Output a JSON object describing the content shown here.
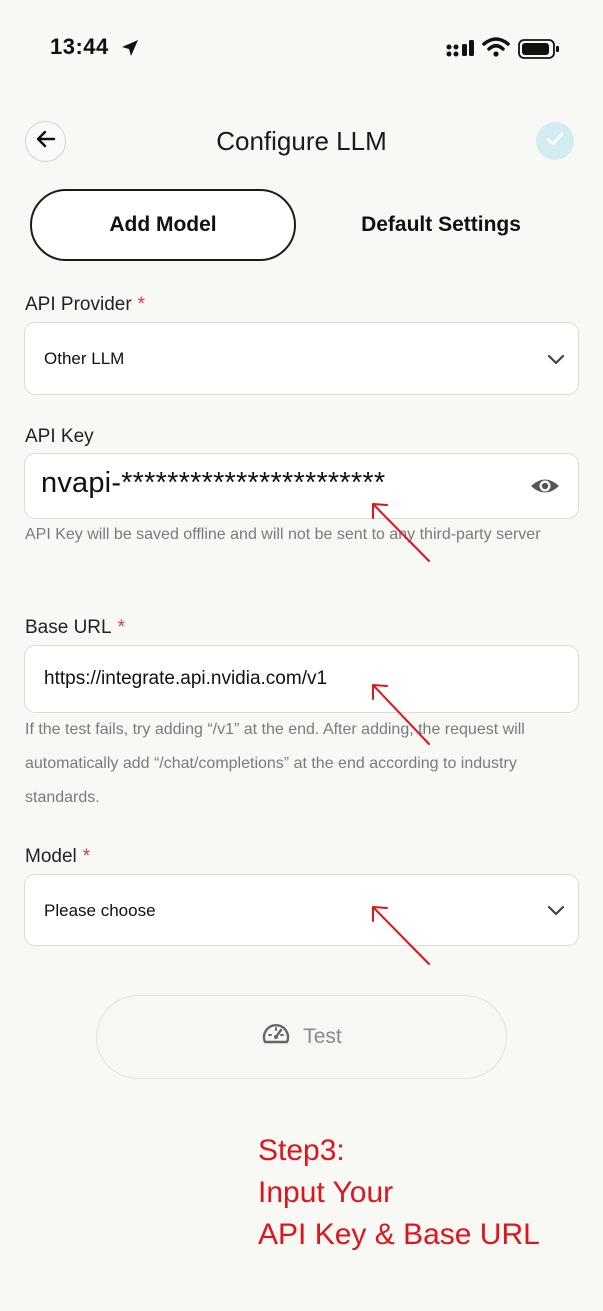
{
  "status_bar": {
    "time": "13:44"
  },
  "header": {
    "title": "Configure LLM"
  },
  "tabs": [
    {
      "label": "Add Model",
      "active": true
    },
    {
      "label": "Default Settings",
      "active": false
    }
  ],
  "form": {
    "provider": {
      "label": "API Provider",
      "required_mark": "*",
      "value": "Other LLM"
    },
    "api_key": {
      "label": "API Key",
      "value": "nvapi-***********************",
      "hint": "API Key will be saved offline and will not be sent to any third-party server"
    },
    "base_url": {
      "label": "Base URL",
      "required_mark": "*",
      "value": "https://integrate.api.nvidia.com/v1",
      "hint": "If the test fails, try adding “/v1” at the end. After adding, the request will automatically add “/chat/completions” at the end according to industry standards."
    },
    "model": {
      "label": "Model",
      "required_mark": "*",
      "placeholder": "Please choose"
    }
  },
  "test_button": {
    "label": "Test"
  },
  "annotation": {
    "line1": "Step3:",
    "line2": "Input Your",
    "line3": "API Key & Base URL"
  },
  "colors": {
    "required": "#e03a3a",
    "annotation": "#e0141c",
    "confirm_bg": "#d3ecf1",
    "confirm_check": "#ffffff"
  },
  "icons": [
    "location-arrow-icon",
    "cellular-signal-icon",
    "wifi-icon",
    "battery-icon",
    "back-arrow-icon",
    "check-icon",
    "chevron-down-icon",
    "eye-icon",
    "speedometer-icon"
  ]
}
